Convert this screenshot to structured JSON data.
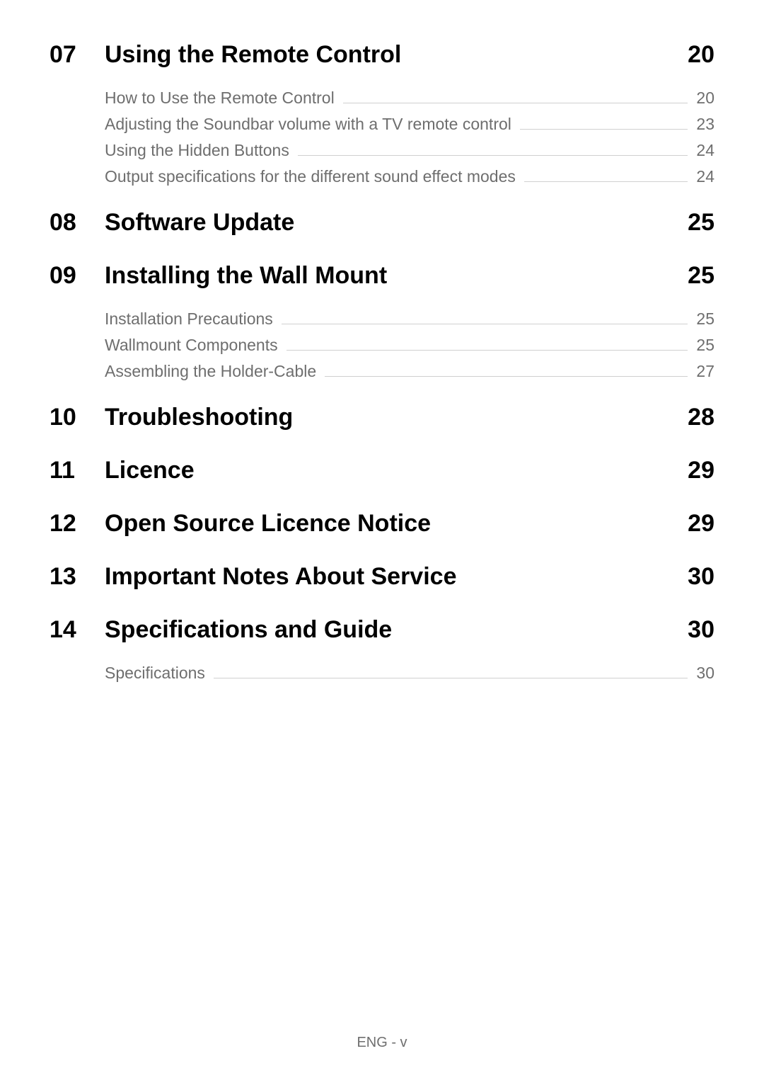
{
  "sections": [
    {
      "number": "07",
      "title": "Using the Remote Control",
      "page": "20",
      "subs": [
        {
          "title": "How to Use the Remote Control",
          "page": "20"
        },
        {
          "title": "Adjusting the Soundbar volume with a TV remote control",
          "page": "23"
        },
        {
          "title": "Using the Hidden Buttons",
          "page": "24"
        },
        {
          "title": "Output specifications for the different sound effect modes",
          "page": "24"
        }
      ]
    },
    {
      "number": "08",
      "title": "Software Update",
      "page": "25",
      "subs": []
    },
    {
      "number": "09",
      "title": "Installing the Wall Mount",
      "page": "25",
      "subs": [
        {
          "title": "Installation Precautions",
          "page": "25"
        },
        {
          "title": "Wallmount Components",
          "page": "25"
        },
        {
          "title": "Assembling the Holder-Cable",
          "page": "27"
        }
      ]
    },
    {
      "number": "10",
      "title": "Troubleshooting",
      "page": "28",
      "subs": []
    },
    {
      "number": "11",
      "title": "Licence",
      "page": "29",
      "subs": []
    },
    {
      "number": "12",
      "title": "Open Source Licence Notice",
      "page": "29",
      "subs": []
    },
    {
      "number": "13",
      "title": "Important Notes About Service",
      "page": "30",
      "subs": []
    },
    {
      "number": "14",
      "title": "Specifications and Guide",
      "page": "30",
      "subs": [
        {
          "title": "Specifications",
          "page": "30"
        }
      ]
    }
  ],
  "footer": "ENG - v"
}
